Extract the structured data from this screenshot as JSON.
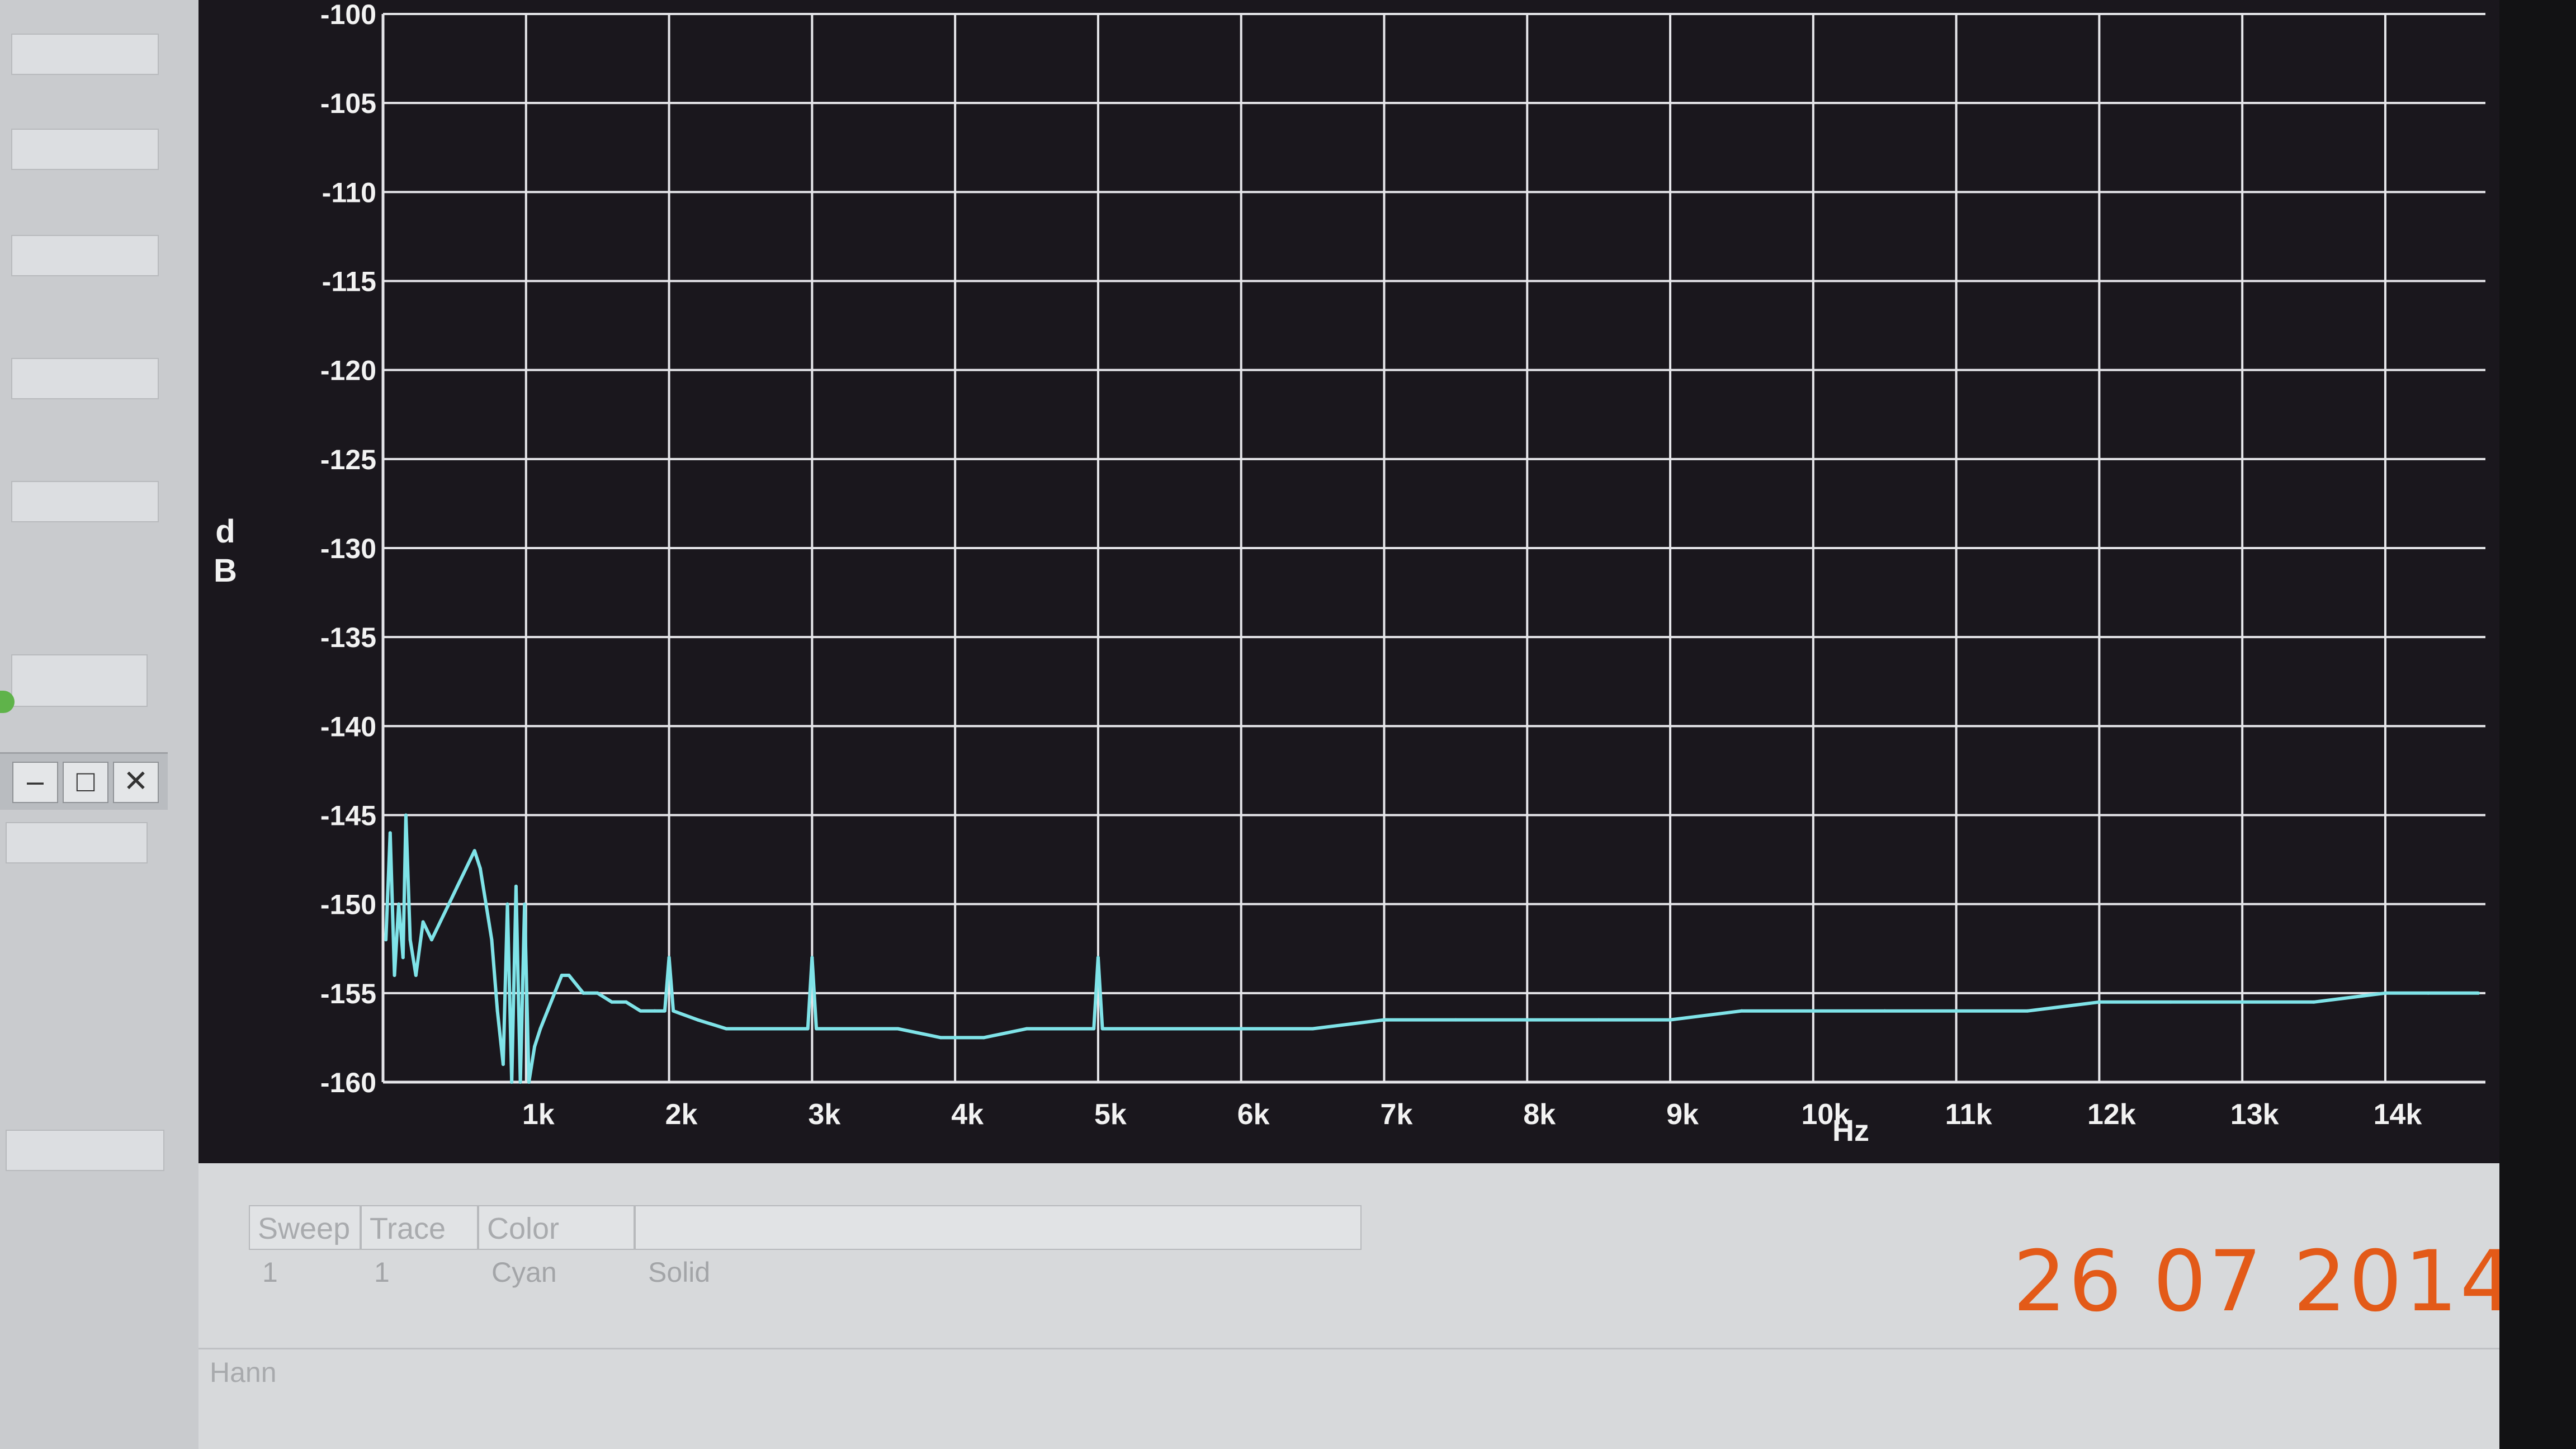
{
  "chart_data": {
    "type": "line",
    "title": "",
    "xlabel": "Hz",
    "ylabel": "dB",
    "x_ticks": [
      {
        "value": 1000,
        "label": "1k"
      },
      {
        "value": 2000,
        "label": "2k"
      },
      {
        "value": 3000,
        "label": "3k"
      },
      {
        "value": 4000,
        "label": "4k"
      },
      {
        "value": 5000,
        "label": "5k"
      },
      {
        "value": 6000,
        "label": "6k"
      },
      {
        "value": 7000,
        "label": "7k"
      },
      {
        "value": 8000,
        "label": "8k"
      },
      {
        "value": 9000,
        "label": "9k"
      },
      {
        "value": 10000,
        "label": "10k"
      },
      {
        "value": 11000,
        "label": "11k"
      },
      {
        "value": 12000,
        "label": "12k"
      },
      {
        "value": 13000,
        "label": "13k"
      },
      {
        "value": 14000,
        "label": "14k"
      }
    ],
    "y_ticks": [
      {
        "value": -100,
        "label": "-100"
      },
      {
        "value": -105,
        "label": "-105"
      },
      {
        "value": -110,
        "label": "-110"
      },
      {
        "value": -115,
        "label": "-115"
      },
      {
        "value": -120,
        "label": "-120"
      },
      {
        "value": -125,
        "label": "-125"
      },
      {
        "value": -130,
        "label": "-130"
      },
      {
        "value": -135,
        "label": "-135"
      },
      {
        "value": -140,
        "label": "-140"
      },
      {
        "value": -145,
        "label": "-145"
      },
      {
        "value": -150,
        "label": "-150"
      },
      {
        "value": -155,
        "label": "-155"
      },
      {
        "value": -160,
        "label": "-160"
      }
    ],
    "xlim": [
      0,
      14700
    ],
    "ylim": [
      -160,
      -100
    ],
    "grid": true,
    "series": [
      {
        "color": "#7fe3e8",
        "points": [
          [
            20,
            -152
          ],
          [
            50,
            -146
          ],
          [
            80,
            -154
          ],
          [
            110,
            -150
          ],
          [
            140,
            -153
          ],
          [
            160,
            -145
          ],
          [
            190,
            -152
          ],
          [
            230,
            -154
          ],
          [
            280,
            -151
          ],
          [
            340,
            -152
          ],
          [
            400,
            -151
          ],
          [
            460,
            -150
          ],
          [
            520,
            -149
          ],
          [
            580,
            -148
          ],
          [
            640,
            -147
          ],
          [
            680,
            -148
          ],
          [
            720,
            -150
          ],
          [
            760,
            -152
          ],
          [
            800,
            -156
          ],
          [
            840,
            -159
          ],
          [
            870,
            -150
          ],
          [
            900,
            -160
          ],
          [
            930,
            -149
          ],
          [
            960,
            -160
          ],
          [
            990,
            -150
          ],
          [
            1020,
            -160
          ],
          [
            1060,
            -158
          ],
          [
            1100,
            -157
          ],
          [
            1150,
            -156
          ],
          [
            1200,
            -155
          ],
          [
            1250,
            -154
          ],
          [
            1300,
            -154
          ],
          [
            1350,
            -154.5
          ],
          [
            1400,
            -155
          ],
          [
            1500,
            -155
          ],
          [
            1600,
            -155.5
          ],
          [
            1700,
            -155.5
          ],
          [
            1800,
            -156
          ],
          [
            1900,
            -156
          ],
          [
            1970,
            -156
          ],
          [
            2000,
            -153
          ],
          [
            2030,
            -156
          ],
          [
            2200,
            -156.5
          ],
          [
            2400,
            -157
          ],
          [
            2600,
            -157
          ],
          [
            2800,
            -157
          ],
          [
            2970,
            -157
          ],
          [
            3000,
            -153
          ],
          [
            3030,
            -157
          ],
          [
            3300,
            -157
          ],
          [
            3600,
            -157
          ],
          [
            3900,
            -157.5
          ],
          [
            4200,
            -157.5
          ],
          [
            4500,
            -157
          ],
          [
            4800,
            -157
          ],
          [
            4970,
            -157
          ],
          [
            5000,
            -153
          ],
          [
            5030,
            -157
          ],
          [
            5500,
            -157
          ],
          [
            6000,
            -157
          ],
          [
            6500,
            -157
          ],
          [
            7000,
            -156.5
          ],
          [
            7500,
            -156.5
          ],
          [
            8000,
            -156.5
          ],
          [
            8500,
            -156.5
          ],
          [
            9000,
            -156.5
          ],
          [
            9500,
            -156
          ],
          [
            10000,
            -156
          ],
          [
            10500,
            -156
          ],
          [
            11000,
            -156
          ],
          [
            11500,
            -156
          ],
          [
            12000,
            -155.5
          ],
          [
            12500,
            -155.5
          ],
          [
            13000,
            -155.5
          ],
          [
            13500,
            -155.5
          ],
          [
            14000,
            -155
          ],
          [
            14300,
            -155
          ],
          [
            14650,
            -155
          ]
        ]
      }
    ]
  },
  "window_controls": {
    "minimize_glyph": "–",
    "maximize_glyph": "□",
    "close_glyph": "✕"
  },
  "trace_table": {
    "headers": [
      "Sweep",
      "Trace",
      "Color"
    ],
    "row": {
      "sweep": "1",
      "trace": "1",
      "color": "Cyan",
      "line": "Solid"
    }
  },
  "window_label": "Hann",
  "timestamp": "26 07 2014",
  "colors": {
    "trace": "#7fe3e8",
    "grid": "#e6e6ea",
    "timestamp": "#e35a18"
  }
}
